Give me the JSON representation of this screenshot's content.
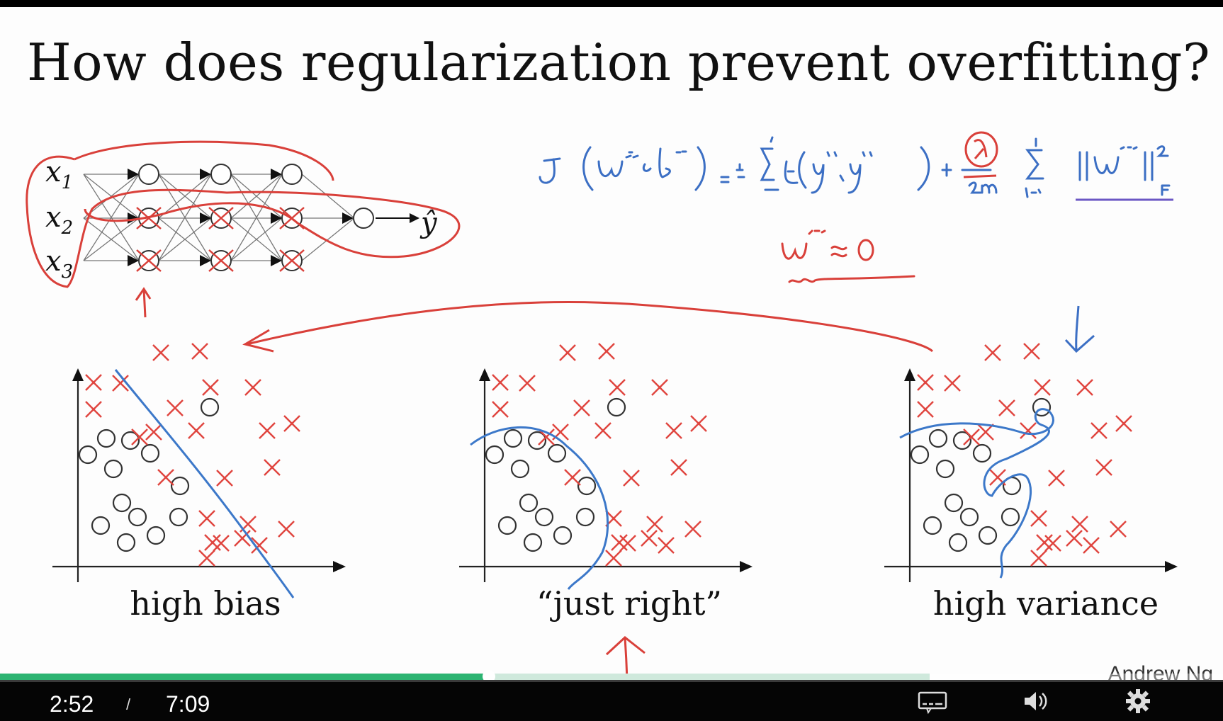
{
  "slide": {
    "title": "How does regularization prevent overfitting?",
    "captions": {
      "high_bias": "high bias",
      "just_right": "“just right”",
      "high_variance": "high variance"
    },
    "author": "Andrew Ng",
    "network_labels": {
      "x1": "x",
      "x1_sub": "1",
      "x2": "x",
      "x2_sub": "2",
      "x3": "x",
      "x3_sub": "3",
      "output": "ŷ"
    },
    "annotation": {
      "cost_function_image": "J(w[l], b[l]) = 1/m Σ L(ŷ(i), y(i)) + λ/2m Σ ||w[l]||²F",
      "approximation_image": "w[l] ≈ 0"
    }
  },
  "player": {
    "current_time": "2:52",
    "separator": "/",
    "duration": "7:09",
    "progress_fraction": 0.4,
    "buffered_fraction": 0.76,
    "colors": {
      "played": "#2db472",
      "buffered": "#cfe9dc"
    },
    "icons": [
      "captions-icon",
      "volume-icon",
      "settings-gear-icon"
    ]
  }
}
